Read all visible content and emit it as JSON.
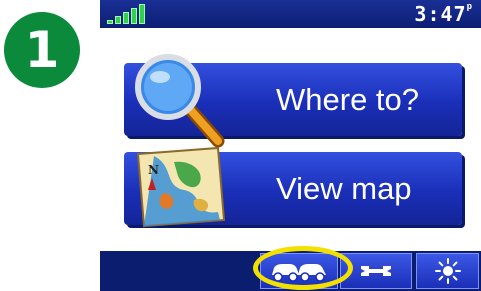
{
  "step_badge": {
    "number": "1"
  },
  "status_bar": {
    "time": "3:47",
    "time_suffix": "p",
    "signal_bars": 4
  },
  "menu": {
    "where_to_label": "Where to?",
    "view_map_label": "View map"
  },
  "bottom_bar": {
    "traffic_icon": "vehicles-icon",
    "tools_icon": "wrench-icon",
    "brightness_icon": "sun-icon"
  },
  "colors": {
    "screen_blue": "#0b1f78",
    "button_blue": "#1a2fb8",
    "highlight_yellow": "#f2e100",
    "badge_green": "#0a8a3a",
    "signal_green": "#2fd24a"
  }
}
